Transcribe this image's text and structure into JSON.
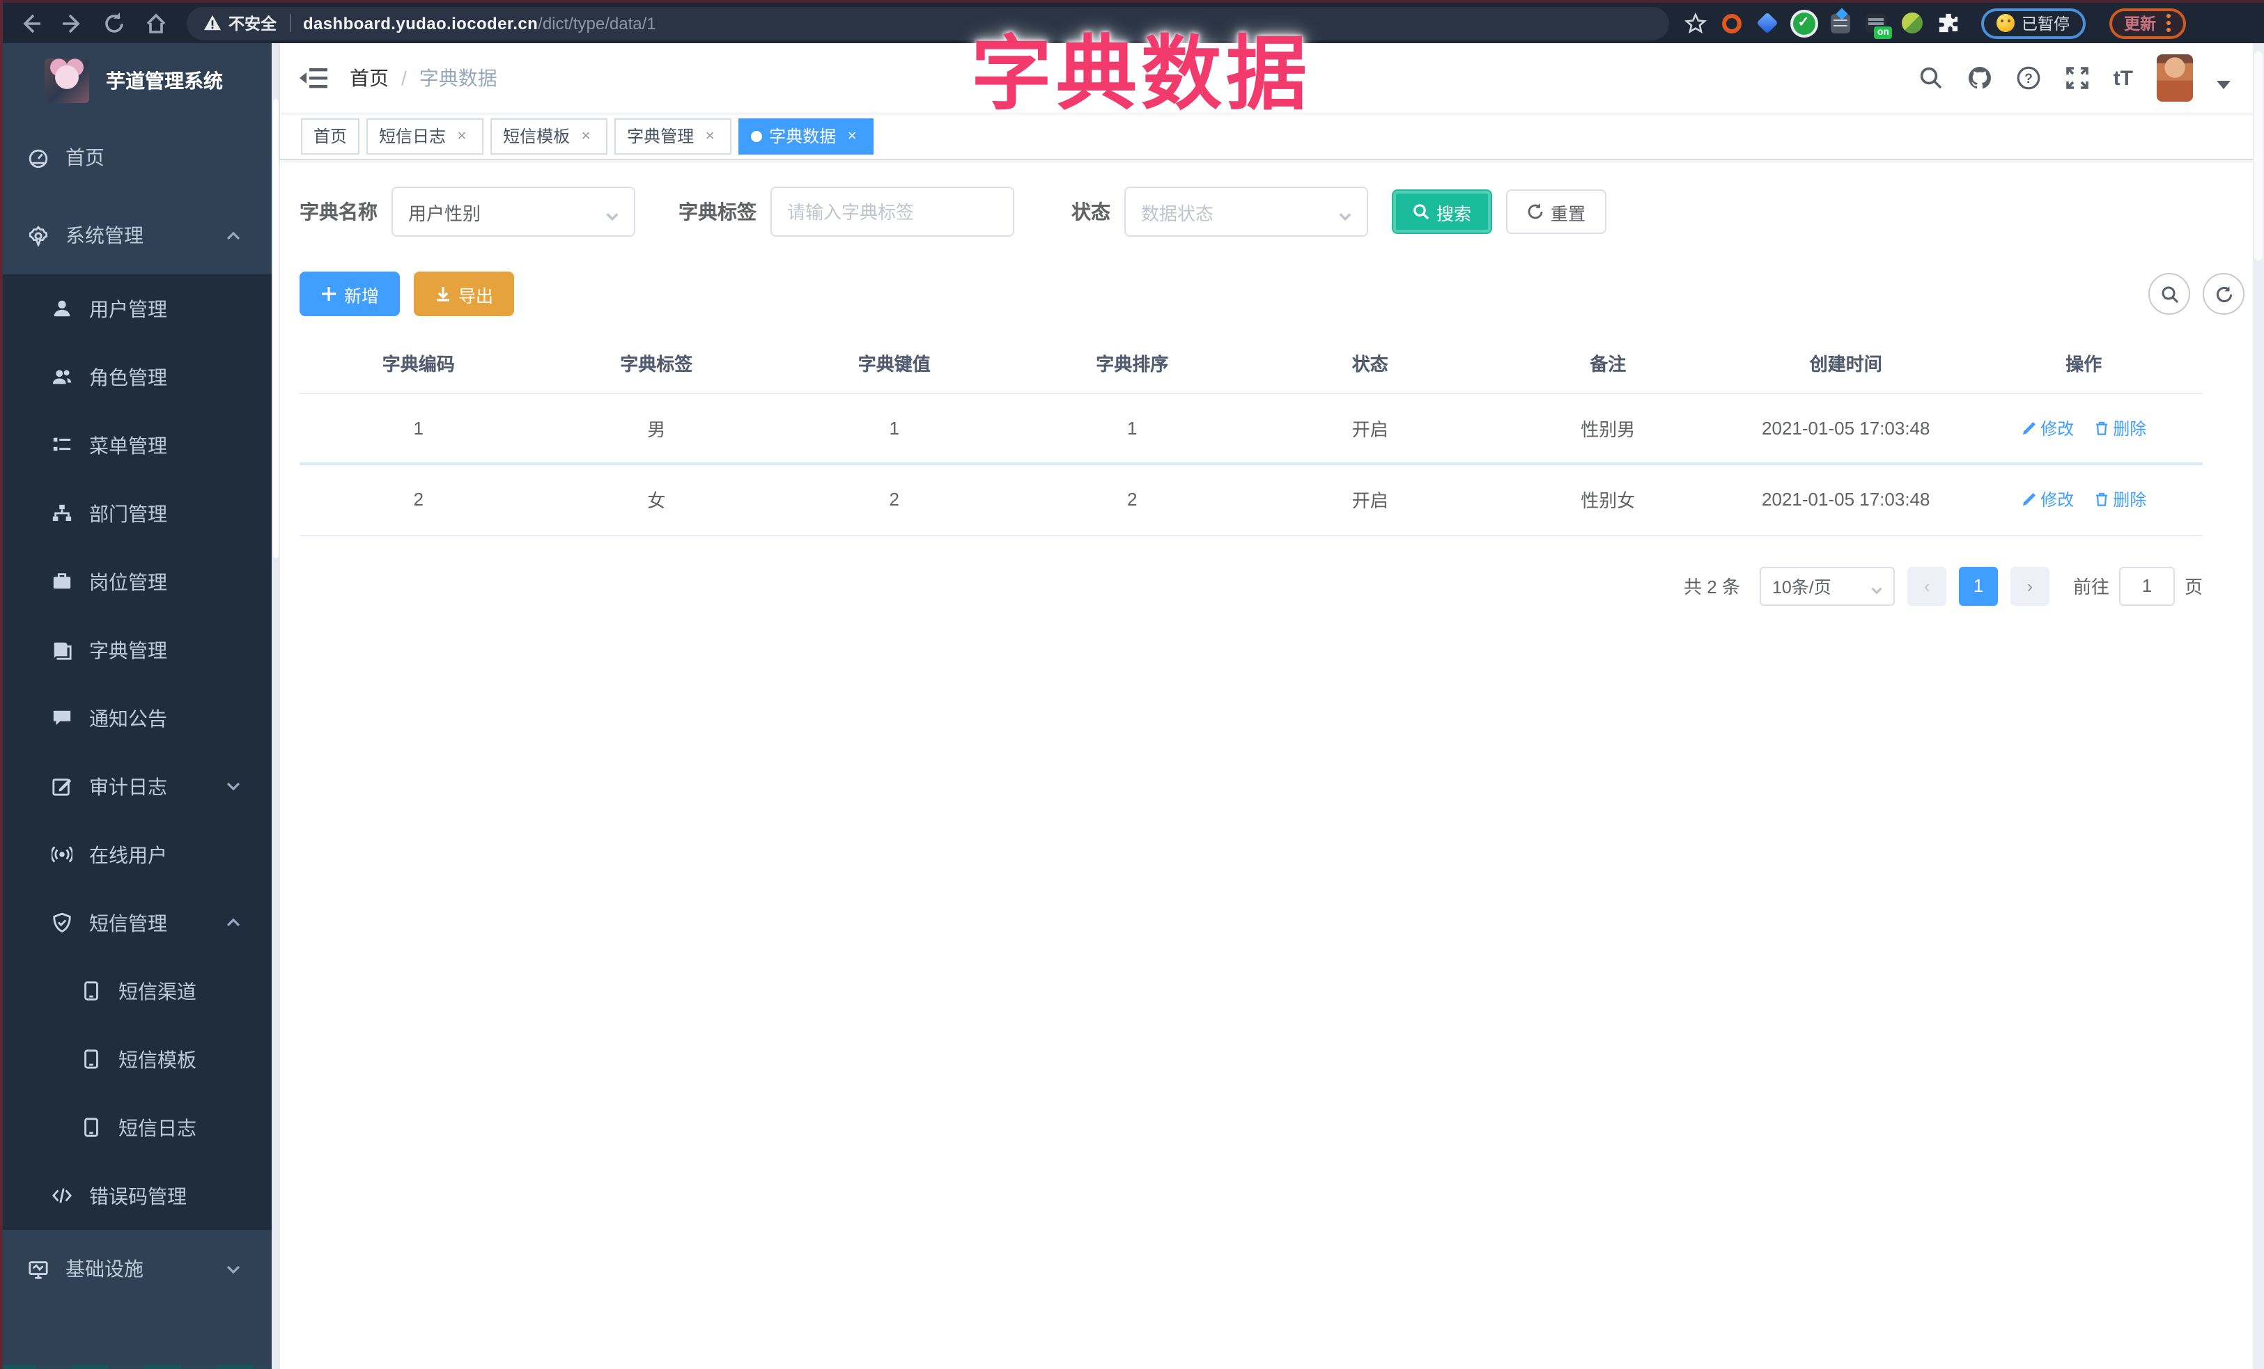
{
  "browser": {
    "security_warning": "不安全",
    "url_domain": "dashboard.yudao.iocoder.cn",
    "url_path": "/dict/type/data/1",
    "paused_badge": "已暂停",
    "update_button": "更新",
    "extension_on_badge": "on"
  },
  "annotation": {
    "title": "字典数据",
    "color": "#f23b6c"
  },
  "sidebar": {
    "app_title": "芋道管理系统",
    "menu": [
      {
        "label": "首页",
        "icon": "dashboard-icon",
        "level": 1,
        "chevron": null
      },
      {
        "label": "系统管理",
        "icon": "gear-icon",
        "level": 1,
        "chevron": "up"
      },
      {
        "label": "用户管理",
        "icon": "user-icon",
        "level": 2,
        "chevron": null
      },
      {
        "label": "角色管理",
        "icon": "users-icon",
        "level": 2,
        "chevron": null
      },
      {
        "label": "菜单管理",
        "icon": "menu-list-icon",
        "level": 2,
        "chevron": null
      },
      {
        "label": "部门管理",
        "icon": "org-tree-icon",
        "level": 2,
        "chevron": null
      },
      {
        "label": "岗位管理",
        "icon": "briefcase-icon",
        "level": 2,
        "chevron": null
      },
      {
        "label": "字典管理",
        "icon": "book-icon",
        "level": 2,
        "chevron": null
      },
      {
        "label": "通知公告",
        "icon": "message-icon",
        "level": 2,
        "chevron": null
      },
      {
        "label": "审计日志",
        "icon": "edit-square-icon",
        "level": 2,
        "chevron": "down"
      },
      {
        "label": "在线用户",
        "icon": "online-icon",
        "level": 2,
        "chevron": null
      },
      {
        "label": "短信管理",
        "icon": "shield-icon",
        "level": 2,
        "chevron": "up"
      },
      {
        "label": "短信渠道",
        "icon": "phone-icon",
        "level": 3,
        "chevron": null
      },
      {
        "label": "短信模板",
        "icon": "phone-icon",
        "level": 3,
        "chevron": null
      },
      {
        "label": "短信日志",
        "icon": "phone-icon",
        "level": 3,
        "chevron": null
      },
      {
        "label": "错误码管理",
        "icon": "code-icon",
        "level": 2,
        "chevron": null
      },
      {
        "label": "基础设施",
        "icon": "monitor-icon",
        "level": 1,
        "chevron": "down"
      }
    ]
  },
  "navbar": {
    "breadcrumb_home": "首页",
    "breadcrumb_separator": "/",
    "breadcrumb_current": "字典数据",
    "font_size_icon_text": "tT"
  },
  "tabs": [
    {
      "label": "首页",
      "active": false,
      "closable": false
    },
    {
      "label": "短信日志",
      "active": false,
      "closable": true
    },
    {
      "label": "短信模板",
      "active": false,
      "closable": true
    },
    {
      "label": "字典管理",
      "active": false,
      "closable": true
    },
    {
      "label": "字典数据",
      "active": true,
      "closable": true
    }
  ],
  "filters": {
    "dict_name_label": "字典名称",
    "dict_name_value": "用户性别",
    "dict_label_label": "字典标签",
    "dict_label_placeholder": "请输入字典标签",
    "status_label": "状态",
    "status_placeholder": "数据状态",
    "search_button": "搜索",
    "reset_button": "重置"
  },
  "toolbar": {
    "add_button": "新增",
    "export_button": "导出"
  },
  "table": {
    "headers": [
      "字典编码",
      "字典标签",
      "字典键值",
      "字典排序",
      "状态",
      "备注",
      "创建时间",
      "操作"
    ],
    "rows": [
      {
        "code": "1",
        "label": "男",
        "value": "1",
        "sort": "1",
        "status": "开启",
        "remark": "性别男",
        "created": "2021-01-05 17:03:48"
      },
      {
        "code": "2",
        "label": "女",
        "value": "2",
        "sort": "2",
        "status": "开启",
        "remark": "性别女",
        "created": "2021-01-05 17:03:48"
      }
    ],
    "edit_action": "修改",
    "delete_action": "删除"
  },
  "pagination": {
    "total_text": "共 2 条",
    "page_size": "10条/页",
    "current_page": "1",
    "goto_label": "前往",
    "goto_value": "1",
    "goto_suffix": "页"
  },
  "colors": {
    "primary": "#409EFF",
    "search_teal": "#1ABC9C",
    "export_orange": "#E6A23C",
    "sidebar_bg": "#304156",
    "submenu_bg": "#1f2d3d",
    "annotation_pink": "#f23b6c"
  }
}
